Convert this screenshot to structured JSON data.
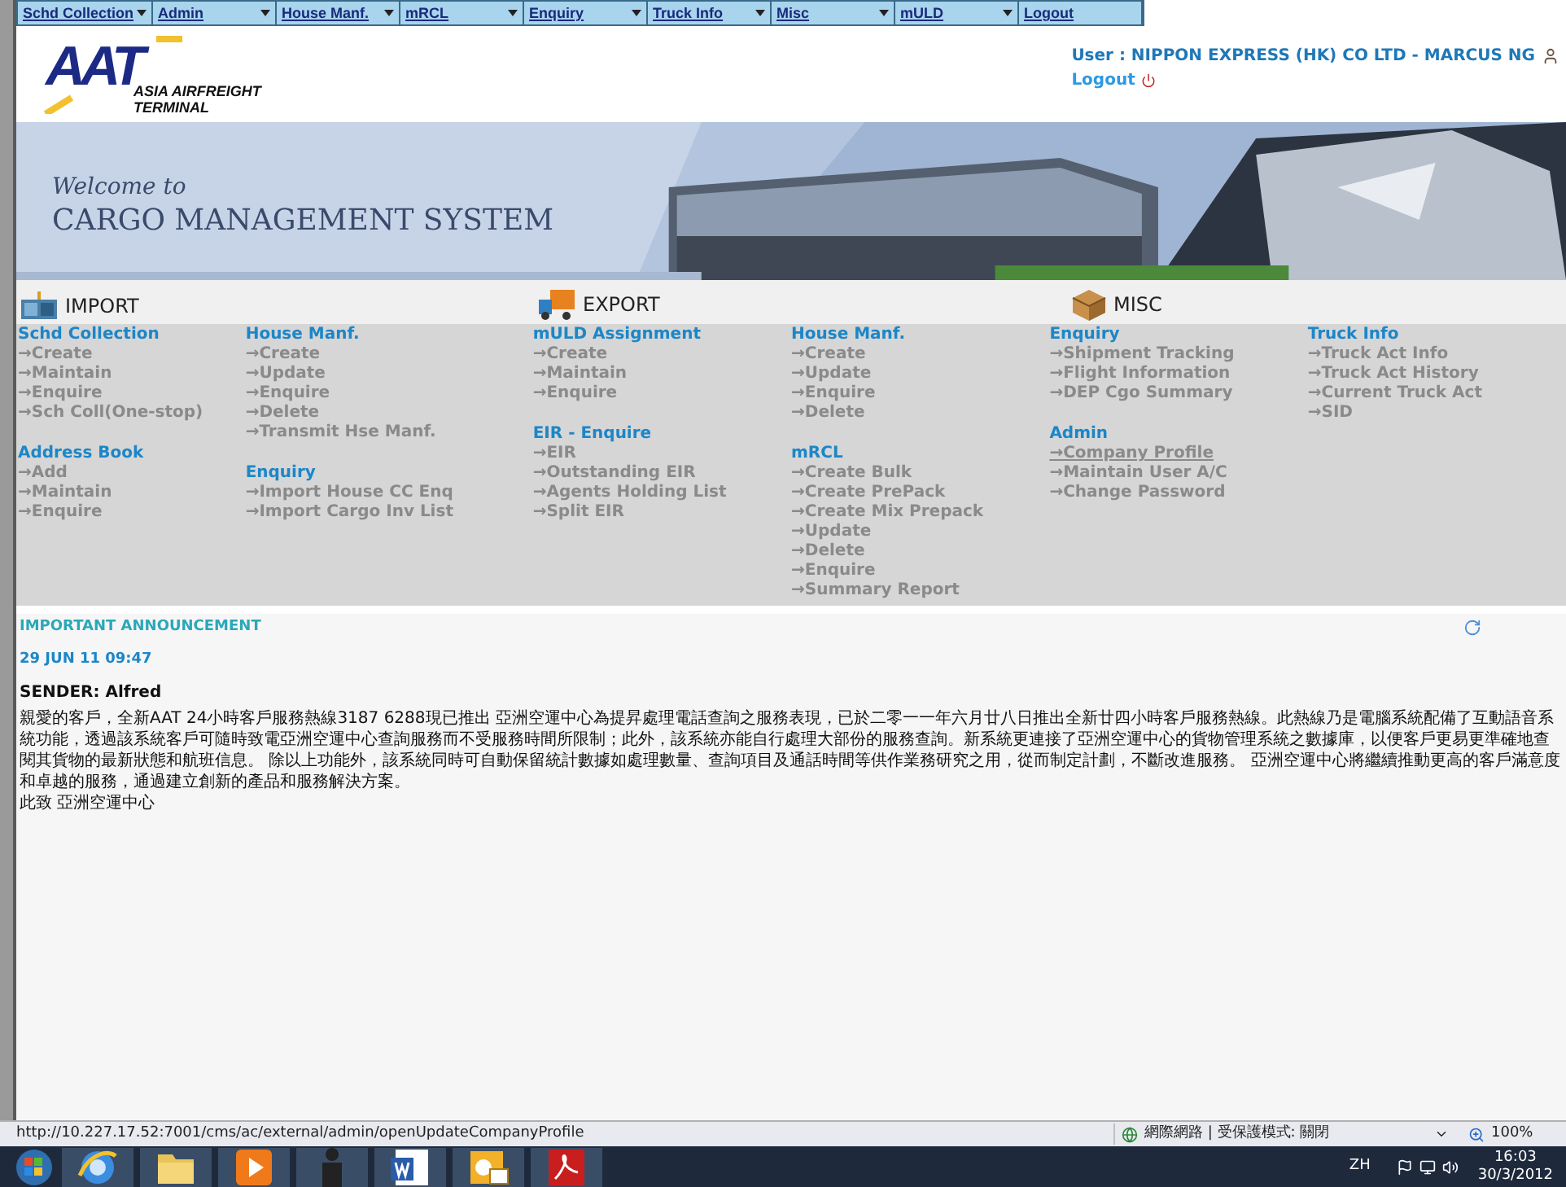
{
  "nav": [
    {
      "label": "Schd Collection",
      "has_menu": true
    },
    {
      "label": "Admin",
      "has_menu": true
    },
    {
      "label": "House Manf.",
      "has_menu": true
    },
    {
      "label": "mRCL",
      "has_menu": true
    },
    {
      "label": "Enquiry",
      "has_menu": true
    },
    {
      "label": "Truck Info",
      "has_menu": true
    },
    {
      "label": "Misc",
      "has_menu": true
    },
    {
      "label": "mULD",
      "has_menu": true
    },
    {
      "label": "Logout",
      "has_menu": false
    }
  ],
  "logo": {
    "mark": "AAT",
    "line_1": "ASIA AIRFREIGHT",
    "line_2": "TERMINAL"
  },
  "user": {
    "label": "User : NIPPON EXPRESS (HK) CO LTD - MARCUS NG",
    "logout": "Logout"
  },
  "banner": {
    "kind": "picture",
    "welcome": "Welcome to",
    "title": "CARGO MANAGEMENT SYSTEM"
  },
  "sections": [
    {
      "title": "IMPORT",
      "kind": "container"
    },
    {
      "title": "EXPORT",
      "kind": "truck"
    },
    {
      "title": "MISC",
      "kind": "box"
    }
  ],
  "columns": [
    [
      {
        "title": "Schd Collection",
        "links": [
          {
            "label": "→Create",
            "hover": false
          },
          {
            "label": "→Maintain",
            "hover": false
          },
          {
            "label": "→Enquire",
            "hover": false
          },
          {
            "label": "→Sch Coll(One-stop)",
            "hover": false
          }
        ]
      },
      {
        "title": "Address Book",
        "links": [
          {
            "label": "→Add",
            "hover": false
          },
          {
            "label": "→Maintain",
            "hover": false
          },
          {
            "label": "→Enquire",
            "hover": false
          }
        ]
      }
    ],
    [
      {
        "title": "House Manf.",
        "links": [
          {
            "label": "→Create",
            "hover": false
          },
          {
            "label": "→Update",
            "hover": false
          },
          {
            "label": "→Enquire",
            "hover": false
          },
          {
            "label": "→Delete",
            "hover": false
          },
          {
            "label": "→Transmit Hse Manf.",
            "hover": false
          }
        ]
      },
      {
        "title": "Enquiry",
        "links": [
          {
            "label": "→Import House CC Enq",
            "hover": false
          },
          {
            "label": "→Import Cargo Inv List",
            "hover": false
          }
        ]
      }
    ],
    [
      {
        "title": "mULD Assignment",
        "links": [
          {
            "label": "→Create",
            "hover": false
          },
          {
            "label": "→Maintain",
            "hover": false
          },
          {
            "label": "→Enquire",
            "hover": false
          }
        ]
      },
      {
        "title": "EIR - Enquire",
        "links": [
          {
            "label": "→EIR",
            "hover": false
          },
          {
            "label": "→Outstanding EIR",
            "hover": false
          },
          {
            "label": "→Agents Holding List",
            "hover": false
          },
          {
            "label": "→Split EIR",
            "hover": false
          }
        ]
      }
    ],
    [
      {
        "title": "House Manf.",
        "links": [
          {
            "label": "→Create",
            "hover": false
          },
          {
            "label": "→Update",
            "hover": false
          },
          {
            "label": "→Enquire",
            "hover": false
          },
          {
            "label": "→Delete",
            "hover": false
          }
        ]
      },
      {
        "title": "mRCL",
        "links": [
          {
            "label": "→Create Bulk",
            "hover": false
          },
          {
            "label": "→Create PrePack",
            "hover": false
          },
          {
            "label": "→Create Mix Prepack",
            "hover": false
          },
          {
            "label": "→Update",
            "hover": false
          },
          {
            "label": "→Delete",
            "hover": false
          },
          {
            "label": "→Enquire",
            "hover": false
          },
          {
            "label": "→Summary Report",
            "hover": false
          }
        ]
      }
    ],
    [
      {
        "title": "Enquiry",
        "links": [
          {
            "label": "→Shipment Tracking",
            "hover": false
          },
          {
            "label": "→Flight Information",
            "hover": false
          },
          {
            "label": "→DEP Cgo Summary",
            "hover": false
          }
        ]
      },
      {
        "title": "Admin",
        "links": [
          {
            "label": "→Company Profile",
            "hover": true
          },
          {
            "label": "→Maintain User A/C",
            "hover": false
          },
          {
            "label": "→Change Password",
            "hover": false
          }
        ]
      }
    ],
    [
      {
        "title": "Truck Info",
        "links": [
          {
            "label": "→Truck Act Info",
            "hover": false
          },
          {
            "label": "→Truck Act History",
            "hover": false
          },
          {
            "label": "→Current Truck Act",
            "hover": false
          },
          {
            "label": "→SID",
            "hover": false
          }
        ]
      }
    ]
  ],
  "announcement": {
    "title": "IMPORTANT ANNOUNCEMENT",
    "date": "29 JUN 11 09:47",
    "sender": "SENDER: Alfred",
    "body": [
      "親愛的客戶，全新AAT 24小時客戶服務熱線3187 6288現已推出 亞洲空運中心為提昇處理電話查詢之服務表現，已於二零一一年六月廿八日推出全新廿四小時客戶服務熱線。此熱線乃是電腦系統配備了互動語音系統功能，透過該系統客戶可隨時致電亞洲空運中心查詢服務而不受服務時間所限制；此外，該系統亦能自行處理大部份的服務查詢。新系統更連接了亞洲空運中心的貨物管理系統之數據庫，以便客戶更易更準確地查閱其貨物的最新狀態和航班信息。 除以上功能外，該系統同時可自動保留統計數據如處理數量、查詢項目及通話時間等供作業務研究之用，從而制定計劃，不斷改進服務。 亞洲空運中心將繼續推動更高的客戶滿意度和卓越的服務，通過建立創新的產品和服務解決方案。",
      "此致 亞洲空運中心"
    ]
  },
  "status_bar": {
    "url": "http://10.227.17.52:7001/cms/ac/external/admin/openUpdateCompanyProfile",
    "zone": "網際網路 | 受保護模式: 關閉",
    "zoom": "100%"
  },
  "taskbar": {
    "language": "ZH",
    "time": "16:03",
    "date": "30/3/2012",
    "apps": [
      {
        "kind": "ie"
      },
      {
        "kind": "folder"
      },
      {
        "kind": "media"
      },
      {
        "kind": "figure"
      },
      {
        "kind": "word"
      },
      {
        "kind": "outlook"
      },
      {
        "kind": "pdf"
      }
    ]
  }
}
